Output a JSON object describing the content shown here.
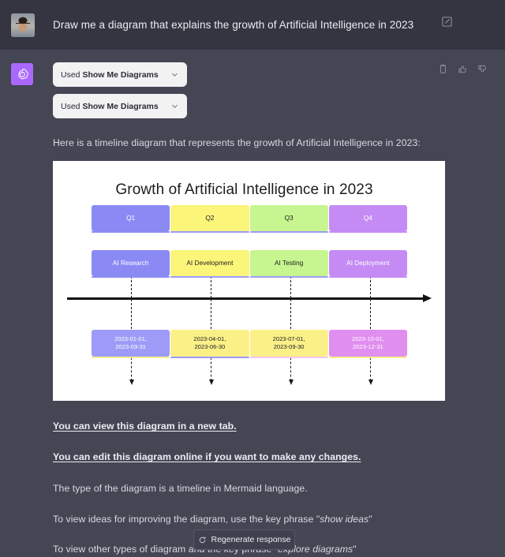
{
  "user_message": {
    "text": "Draw me a diagram that explains the growth of Artificial Intelligence in 2023",
    "avatar_alt": "user-avatar",
    "edit_icon": "edit-icon"
  },
  "assistant": {
    "logo": "openai-logo",
    "action_icons": [
      "copy-icon",
      "thumbs-up-icon",
      "thumbs-down-icon"
    ],
    "plugins": [
      {
        "prefix": "Used ",
        "name": "Show Me Diagrams",
        "chevron": "chevron-down-icon"
      },
      {
        "prefix": "Used ",
        "name": "Show Me Diagrams",
        "chevron": "chevron-down-icon"
      }
    ],
    "intro": "Here is a timeline diagram that represents the growth of Artificial Intelligence in 2023:",
    "links": [
      "You can view this diagram in a new tab.",
      "You can edit this diagram online if you want to make any changes."
    ],
    "paragraphs": [
      "The type of the diagram is a timeline in Mermaid language.",
      "To view ideas for improving the diagram, use the key phrase \"show ideas\"",
      "To view other types of diagram and the phrase \"explore diagrams\""
    ],
    "para3_pre": "To view other types of diagram and",
    "para3_post": "hrase \"explore diagrams\""
  },
  "chart_data": {
    "type": "table",
    "title": "Growth of Artificial Intelligence in 2023",
    "subtitle": "",
    "xlabel": "",
    "ylabel": "",
    "legend": [],
    "categories": [
      "Q1",
      "Q2",
      "Q3",
      "Q4"
    ],
    "rows": [
      {
        "quarter": "Q1",
        "event": "AI Research",
        "dates": "2023-01-01,\n2023-03-31",
        "box_color": "#8b8af5",
        "date_box_color": "#9d9bf7",
        "text_color": "#ffffff",
        "date_text_color": "#ffffff"
      },
      {
        "quarter": "Q2",
        "event": "AI Development",
        "dates": "2023-04-01,\n2023-06-30",
        "box_color": "#fbf579",
        "date_box_color": "#fbf088",
        "text_color": "#222222",
        "date_text_color": "#222222"
      },
      {
        "quarter": "Q3",
        "event": "AI Testing",
        "dates": "2023-07-01,\n2023-09-30",
        "box_color": "#c7f58f",
        "date_box_color": "#fbf088",
        "text_color": "#222222",
        "date_text_color": "#222222"
      },
      {
        "quarter": "Q4",
        "event": "AI Deployment",
        "dates": "2023-10-01,\n2023-12-31",
        "box_color": "#c48bf5",
        "date_box_color": "#e08ef0",
        "text_color": "#ffffff",
        "date_text_color": "#ffffff"
      }
    ],
    "axis": {
      "type": "timeline-arrow",
      "direction": "left-to-right"
    },
    "grid": false
  },
  "regenerate": {
    "label": "Regenerate response",
    "icon": "refresh-icon"
  },
  "colors": {
    "page_bg": "#444654",
    "user_row_bg": "#343541",
    "accent_purple": "#ab68ff",
    "card_bg": "#ffffff",
    "text_primary": "#ececf1"
  }
}
